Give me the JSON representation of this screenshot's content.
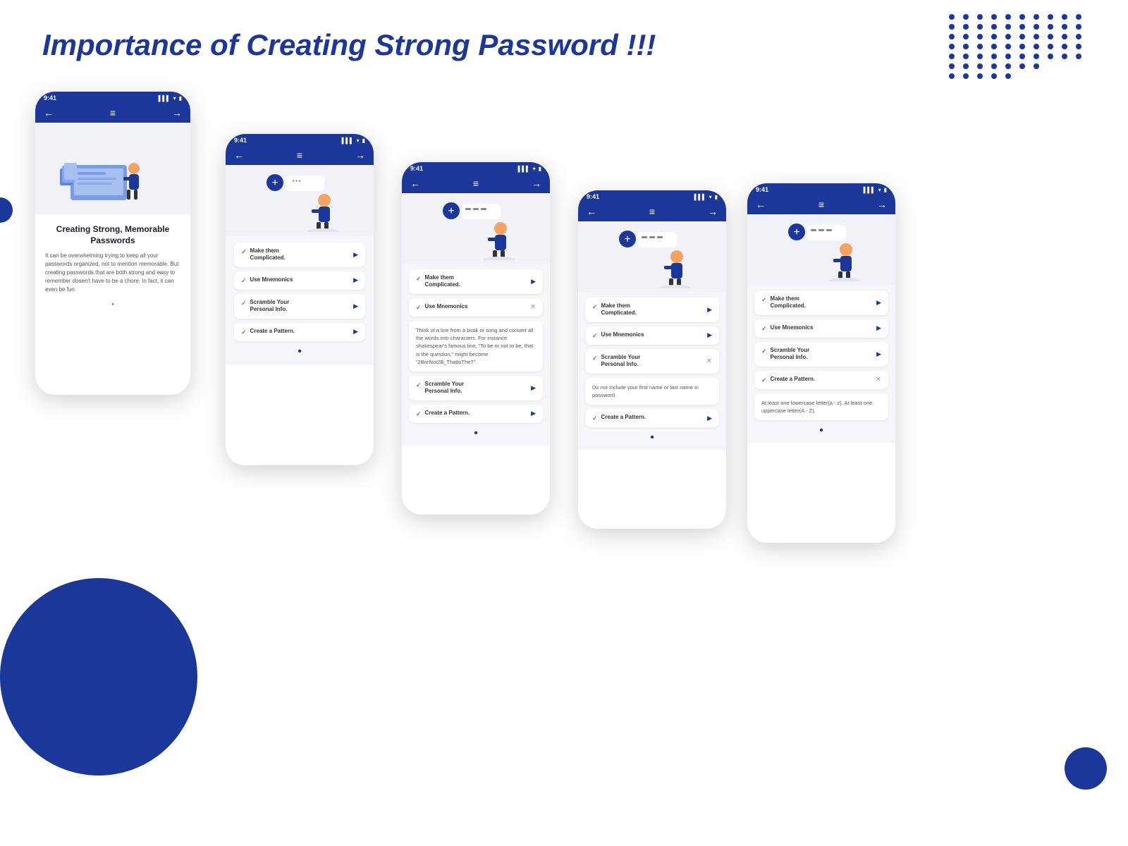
{
  "page": {
    "title": "Importance of Creating Strong Password !!!"
  },
  "phone1": {
    "time": "9:41",
    "illustration_alt": "Person organizing folders",
    "content_title": "Creating Strong, Memorable Passwords",
    "content_text": "It can be overwhelming trying to keep all your passwords organized, not to mention memorable. But creating passwords that are both strong and easy to remember dosen't have to be a chore. In fact, it can even be fun.",
    "dot_indicator": "•"
  },
  "phone2": {
    "time": "9:41",
    "menu_items": [
      {
        "label": "Make them Complicated.",
        "expanded": false
      },
      {
        "label": "Use Mnemonics",
        "expanded": false
      },
      {
        "label": "Scramble Your Personal Info.",
        "expanded": false
      },
      {
        "label": "Create a Pattern.",
        "expanded": false
      }
    ],
    "dot_indicator": "•"
  },
  "phone3": {
    "time": "9:41",
    "menu_items": [
      {
        "label": "Make them Complicated.",
        "expanded": false,
        "icon": "arrow"
      },
      {
        "label": "Use Mnemonics",
        "expanded": true,
        "icon": "x"
      },
      {
        "label": "Scramble Your Personal Info.",
        "expanded": false,
        "icon": "arrow"
      },
      {
        "label": "Create a Pattern.",
        "expanded": false,
        "icon": "arrow"
      }
    ],
    "expanded_item": "Use Mnemonics",
    "expanded_text": "Think of a line from a book or song and convert all the words into characters. For instance shakespear's famous line, \"To be or not to be, that is the question,\" might become \"2BorNot2B_ThatIsThe?\".",
    "dot_indicator": "•"
  },
  "phone4": {
    "time": "9:41",
    "menu_items": [
      {
        "label": "Make them Complicated.",
        "expanded": false,
        "icon": "arrow"
      },
      {
        "label": "Use Mnemonics",
        "expanded": false,
        "icon": "arrow"
      },
      {
        "label": "Scramble Your Personal Info.",
        "expanded": true,
        "icon": "x"
      },
      {
        "label": "Create a Pattern.",
        "expanded": false,
        "icon": "arrow"
      }
    ],
    "expanded_item": "Scramble Your Personal Info.",
    "expanded_text": "Do not include your first name or last name in password.",
    "dot_indicator": "•"
  },
  "phone5": {
    "time": "9:41",
    "menu_items": [
      {
        "label": "Make them Complicated.",
        "expanded": false,
        "icon": "arrow"
      },
      {
        "label": "Use Mnemonics",
        "expanded": false,
        "icon": "arrow"
      },
      {
        "label": "Scramble Your Personal Info.",
        "expanded": false,
        "icon": "arrow"
      },
      {
        "label": "Create a Pattern.",
        "expanded": true,
        "icon": "x"
      }
    ],
    "expanded_item": "Create a Pattern.",
    "expanded_text": "At least one lowercase letter(a - z). At least one uppercase letter(A - Z).",
    "dot_indicator": "•"
  },
  "colors": {
    "primary": "#1a3799",
    "background": "#f5f6fa",
    "text_dark": "#1a1a2e",
    "text_muted": "#555555"
  }
}
